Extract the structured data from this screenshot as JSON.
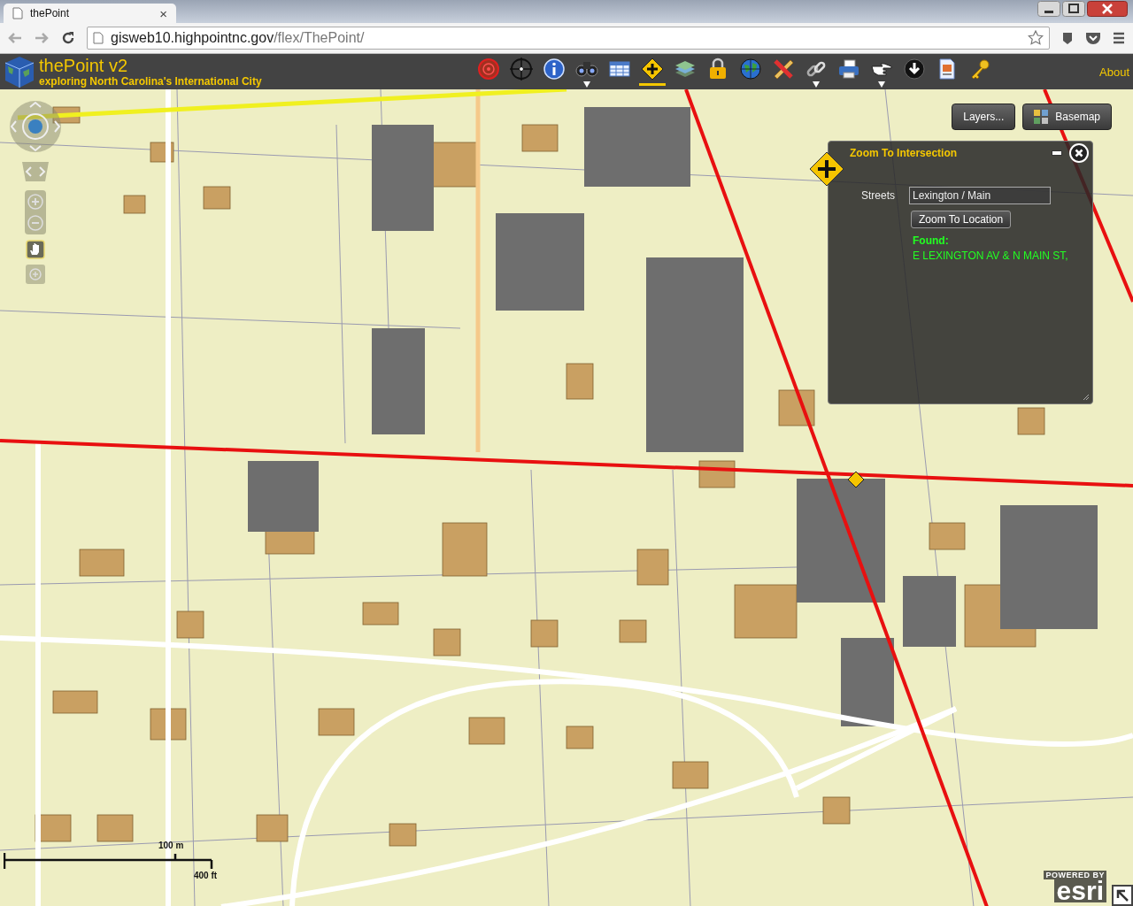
{
  "browser": {
    "tabs": [
      {
        "title": "thePoint",
        "close": "×",
        "selected": true
      }
    ],
    "address": {
      "host": "gisweb10.highpointnc.gov",
      "path": "/flex/ThePoint/"
    }
  },
  "app": {
    "title": "thePoint v2",
    "subtitle": "exploring North Carolina's International City",
    "about": "About"
  },
  "toolbar": [
    {
      "kind": "target",
      "selected": false,
      "menu": false
    },
    {
      "kind": "crosshair",
      "selected": false,
      "menu": false
    },
    {
      "kind": "info",
      "selected": false,
      "menu": false
    },
    {
      "kind": "binoculars",
      "selected": false,
      "menu": true
    },
    {
      "kind": "table",
      "selected": false,
      "menu": false
    },
    {
      "kind": "sign",
      "selected": true,
      "menu": false
    },
    {
      "kind": "layers",
      "selected": false,
      "menu": false
    },
    {
      "kind": "lock",
      "selected": false,
      "menu": false
    },
    {
      "kind": "globe",
      "selected": false,
      "menu": false
    },
    {
      "kind": "pencil",
      "selected": false,
      "menu": false
    },
    {
      "kind": "link",
      "selected": false,
      "menu": true
    },
    {
      "kind": "printer",
      "selected": false,
      "menu": false
    },
    {
      "kind": "hand",
      "selected": false,
      "menu": true
    },
    {
      "kind": "download",
      "selected": false,
      "menu": false
    },
    {
      "kind": "document",
      "selected": false,
      "menu": false
    },
    {
      "kind": "key",
      "selected": false,
      "menu": false
    }
  ],
  "map": {
    "buttons": [
      {
        "kind": "layers",
        "label": "Layers..."
      },
      {
        "kind": "basemap",
        "label": "Basemap"
      }
    ],
    "scale": {
      "metric": "100 m",
      "imperial": "400 ft"
    },
    "attribution": {
      "caption": "POWERED BY",
      "logo": "esri"
    }
  },
  "widget": {
    "title": "Zoom To Intersection",
    "field_label": "Streets",
    "value": "Lexington / Main",
    "button": "Zoom To Location",
    "result_label": "Found:",
    "result": "E LEXINGTON AV & N MAIN ST,"
  }
}
